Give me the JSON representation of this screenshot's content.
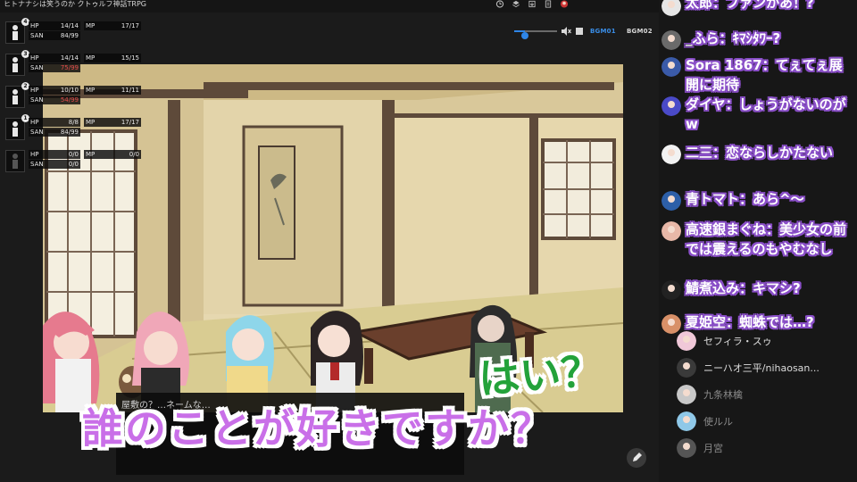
{
  "room_title": "ヒトナナシは笑うのか クトゥルフ神話TRPG",
  "toolbar": {
    "icons": [
      "clock-icon",
      "layers-icon",
      "export-icon",
      "document-icon",
      "avatar-icon"
    ]
  },
  "audio": {
    "volume_fraction": 0.25,
    "bgm1_label": "BGM01",
    "bgm2_label": "BGM02",
    "accent": "#2f86e8"
  },
  "characters": [
    {
      "number": "4",
      "hp_label": "HP",
      "hp": "14/14",
      "mp_label": "MP",
      "mp": "17/17",
      "san_label": "SAN",
      "san": "84/99",
      "san_low": false
    },
    {
      "number": "3",
      "hp_label": "HP",
      "hp": "14/14",
      "mp_label": "MP",
      "mp": "15/15",
      "san_label": "SAN",
      "san": "75/99",
      "san_low": true
    },
    {
      "number": "2",
      "hp_label": "HP",
      "hp": "10/10",
      "mp_label": "MP",
      "mp": "11/11",
      "san_label": "SAN",
      "san": "54/99",
      "san_low": true
    },
    {
      "number": "1",
      "hp_label": "HP",
      "hp": "8/8",
      "mp_label": "MP",
      "mp": "17/17",
      "san_label": "SAN",
      "san": "84/99",
      "san_low": false
    },
    {
      "number": "",
      "hp_label": "HP",
      "hp": "0/0",
      "mp_label": "MP",
      "mp": "0/0",
      "san_label": "SAN",
      "san": "0/0",
      "san_low": false
    }
  ],
  "chat": [
    {
      "name": "太郎",
      "text": "：ファンかあ！?"
    },
    {
      "name": "_ふら",
      "text": "：ｷﾏｼﾀﾜｰ?"
    },
    {
      "name": "Sora 1867",
      "text": "：てぇてぇ展開に期待"
    },
    {
      "name": "ダイヤ",
      "text": "：しょうがないのがw"
    },
    {
      "name": "二三",
      "text": "：恋ならしかたない"
    },
    {
      "name": "青トマト",
      "text": "：あら^～"
    },
    {
      "name": "高速銀まぐね",
      "text": "：美少女の前では震えるのもやむなし"
    },
    {
      "name": "鯖煮込み",
      "text": "：キマシ?"
    },
    {
      "name": "夏姫空",
      "text": "：蜘蛛では…?"
    }
  ],
  "members": [
    {
      "name": "セフィラ・スゥ"
    },
    {
      "name": "ニーハオ三平/nihaosan..."
    },
    {
      "name": "九条林檎"
    },
    {
      "name": "使ルル"
    },
    {
      "name": "月宮"
    }
  ],
  "captions": {
    "main": "誰のことが好きですか？",
    "reply": "はい？"
  },
  "dialog": {
    "text": "屋敷の？…ネームな…"
  },
  "colors": {
    "chat_outline": "#8a4fc8",
    "caption_main": "#c96fe8",
    "caption_reply": "#23a23a",
    "san_low": "#e24a4a"
  }
}
